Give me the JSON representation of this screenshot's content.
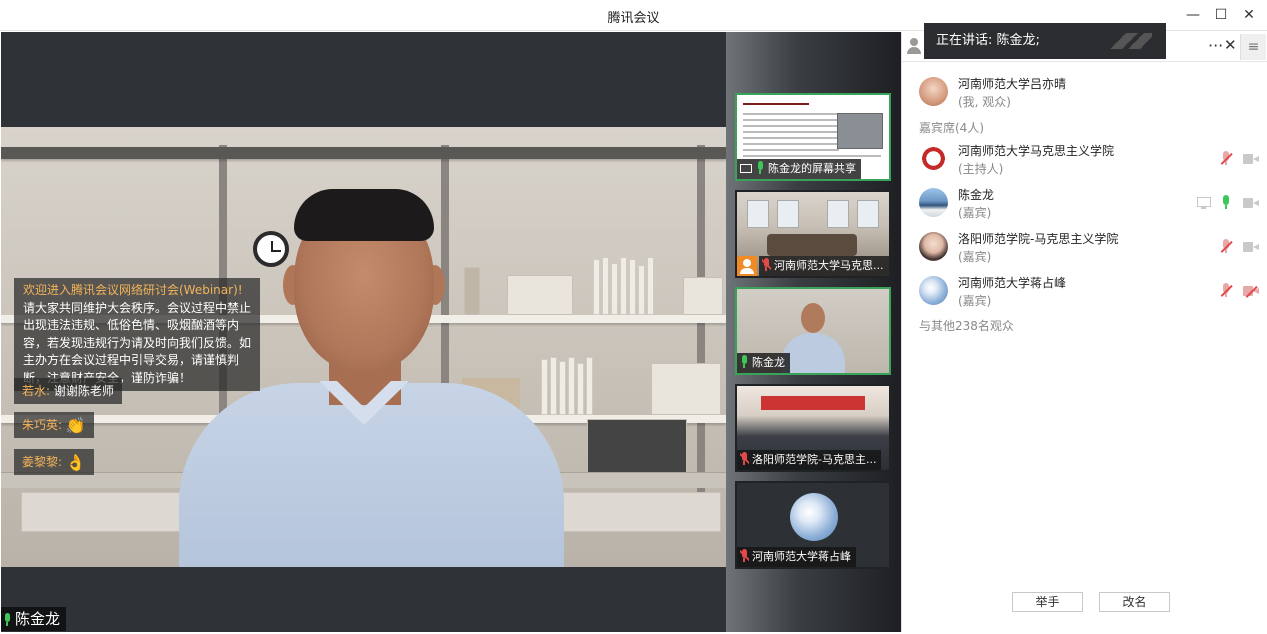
{
  "window": {
    "title": "腾讯会议"
  },
  "main": {
    "notice_highlight": "欢迎进入腾讯会议网络研讨会(Webinar)!",
    "notice_body": "请大家共同维护大会秩序。会议过程中禁止出现违法违规、低俗色情、吸烟酗酒等内容，若发现违规行为请及时向我们反馈。如主办方在会议过程中引导交易，请谨慎判断，注意财产安全，谨防诈骗！",
    "chats": [
      {
        "name": "若水:",
        "text": "谢谢陈老师",
        "emoji": ""
      },
      {
        "name": "朱巧英:",
        "text": "",
        "emoji": "👏"
      },
      {
        "name": "姜黎黎:",
        "text": "",
        "emoji": "👌"
      }
    ],
    "speaker": "陈金龙"
  },
  "thumbs": [
    {
      "caption": "陈金龙的屏幕共享"
    },
    {
      "caption": "河南师范大学马克思..."
    },
    {
      "caption": "陈金龙"
    },
    {
      "caption": "洛阳师范学院-马克思主..."
    },
    {
      "caption": "河南师范大学蒋占峰"
    }
  ],
  "panel": {
    "talking_label": "正在讲话: 陈金龙;",
    "more": "···",
    "close": "✕",
    "menu": "≡",
    "me": {
      "name": "河南师范大学吕亦晴",
      "role": "(我, 观众)"
    },
    "guests_label": "嘉宾席(4人)",
    "guests": [
      {
        "name": "河南师范大学马克思主义学院",
        "role": "(主持人)"
      },
      {
        "name": "陈金龙",
        "role": "(嘉宾)"
      },
      {
        "name": "洛阳师范学院-马克思主义学院",
        "role": "(嘉宾)"
      },
      {
        "name": "河南师范大学蒋占峰",
        "role": "(嘉宾)"
      }
    ],
    "audience_label": "与其他238名观众",
    "raise_hand": "举手",
    "rename": "改名"
  },
  "colors": {
    "active_border": "#3aa35a",
    "highlight": "#f3b45a",
    "mic_on": "#3fc659",
    "mic_off": "#e24a4a"
  }
}
